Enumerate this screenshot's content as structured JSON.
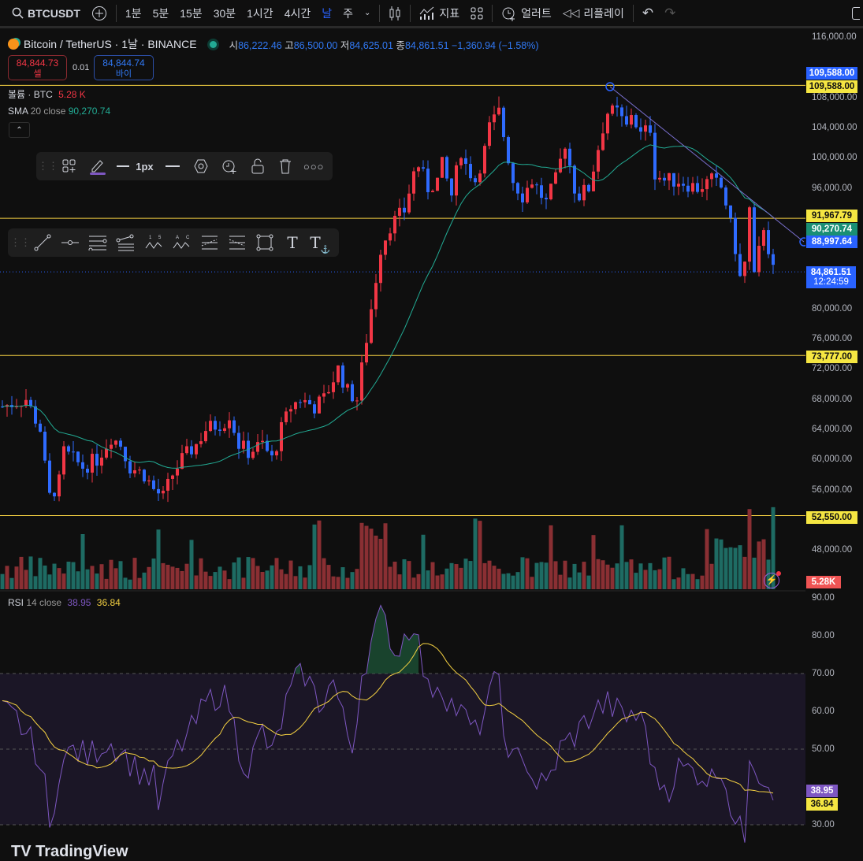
{
  "topbar": {
    "symbol": "BTCUSDT",
    "intervals": [
      "1분",
      "5분",
      "15분",
      "30분",
      "1시간",
      "4시간",
      "날",
      "주"
    ],
    "active_interval": "날",
    "indicators": "지표",
    "alert": "얼러트",
    "replay": "리플레이"
  },
  "legend": {
    "title": "Bitcoin / TetherUS · 1날 · BINANCE",
    "o_label": "시",
    "o": "86,222.46",
    "h_label": "고",
    "h": "86,500.00",
    "l_label": "저",
    "l": "84,625.01",
    "c_label": "종",
    "c": "84,861.51",
    "change": "−1,360.94 (−1.58%)",
    "sell_price": "84,844.73",
    "sell_label": "셀",
    "spread": "0.01",
    "buy_price": "84,844.74",
    "buy_label": "바이"
  },
  "indicators": {
    "volume_label": "볼륨 · BTC",
    "volume_value": "5.28 K",
    "sma_label": "SMA",
    "sma_params": "20 close",
    "sma_value": "90,270.74",
    "rsi_label": "RSI",
    "rsi_params": "14 close",
    "rsi_value": "38.95",
    "rsi_ma_value": "36.84"
  },
  "drawing_toolbar": {
    "width_label": "1px"
  },
  "price_axis": {
    "labels": [
      "116,000.00",
      "108,000.00",
      "104,000.00",
      "100,000.00",
      "96,000.00",
      "80,000.00",
      "76,000.00",
      "72,000.00",
      "68,000.00",
      "64,000.00",
      "60,000.00",
      "56,000.00",
      "48,000.00"
    ],
    "label_values": [
      116000,
      108000,
      104000,
      100000,
      96000,
      80000,
      76000,
      72000,
      68000,
      64000,
      60000,
      56000,
      48000
    ],
    "tags": {
      "trend_high": "109,588.00",
      "hline_high": "109,588.00",
      "hline_mid": "91,967.79",
      "sma": "90,270.74",
      "trend_end": "88,997.64",
      "last": "84,861.51",
      "countdown": "12:24:59",
      "hline_low1": "73,777.00",
      "hline_low2": "52,550.00",
      "volume": "5.28K"
    }
  },
  "rsi_axis": {
    "labels": [
      "90.00",
      "80.00",
      "70.00",
      "60.00",
      "50.00",
      "30.00"
    ],
    "values": [
      90,
      80,
      70,
      60,
      50,
      30
    ],
    "tags": {
      "rsi": "38.95",
      "rsi_ma": "36.84"
    }
  },
  "horizontal_lines": [
    109588,
    91967.79,
    73777,
    52550
  ],
  "last_price": 84861.51,
  "colors": {
    "up": "#f23645",
    "down": "#2f6bff",
    "sma": "#22ab94",
    "rsi": "#7e57c2",
    "rsi_ma": "#f5d142",
    "hline": "#f5d142",
    "vol_up": "#8a2f33",
    "vol_down": "#1e6b63"
  },
  "chart_data": {
    "type": "candlestick",
    "price_waypoints": [
      [
        0,
        67000
      ],
      [
        5,
        68000
      ],
      [
        8,
        64000
      ],
      [
        9,
        59000
      ],
      [
        10,
        55000
      ],
      [
        12,
        57000
      ],
      [
        13,
        61000
      ],
      [
        17,
        59000
      ],
      [
        20,
        60000
      ],
      [
        23,
        63000
      ],
      [
        25,
        62000
      ],
      [
        27,
        59000
      ],
      [
        30,
        58000
      ],
      [
        32,
        56000
      ],
      [
        34,
        55000
      ],
      [
        36,
        58000
      ],
      [
        38,
        60000
      ],
      [
        41,
        62000
      ],
      [
        43,
        64000
      ],
      [
        47,
        65000
      ],
      [
        48,
        66000
      ],
      [
        50,
        62000
      ],
      [
        52,
        61000
      ],
      [
        55,
        62000
      ],
      [
        57,
        60000
      ],
      [
        59,
        64000
      ],
      [
        61,
        67000
      ],
      [
        63,
        68000
      ],
      [
        66,
        67000
      ],
      [
        68,
        68000
      ],
      [
        71,
        72000
      ],
      [
        73,
        69000
      ],
      [
        75,
        68000
      ],
      [
        77,
        76000
      ],
      [
        78,
        80000
      ],
      [
        80,
        88000
      ],
      [
        82,
        91000
      ],
      [
        85,
        93000
      ],
      [
        87,
        98000
      ],
      [
        88,
        99000
      ],
      [
        90,
        96000
      ],
      [
        92,
        97000
      ],
      [
        93,
        99000
      ],
      [
        95,
        95000
      ],
      [
        97,
        101000
      ],
      [
        98,
        99000
      ],
      [
        100,
        97000
      ],
      [
        102,
        101000
      ],
      [
        103,
        104000
      ],
      [
        105,
        106000
      ],
      [
        107,
        100000
      ],
      [
        108,
        97000
      ],
      [
        110,
        95000
      ],
      [
        112,
        97000
      ],
      [
        115,
        94000
      ],
      [
        117,
        97000
      ],
      [
        119,
        102000
      ],
      [
        121,
        96000
      ],
      [
        122,
        95000
      ],
      [
        124,
        96000
      ],
      [
        127,
        104000
      ],
      [
        128,
        106000
      ],
      [
        130,
        106000
      ],
      [
        132,
        104000
      ],
      [
        133,
        106000
      ],
      [
        135,
        103000
      ],
      [
        137,
        104000
      ],
      [
        138,
        98000
      ],
      [
        140,
        97000
      ],
      [
        143,
        97000
      ],
      [
        147,
        96000
      ],
      [
        150,
        97000
      ],
      [
        152,
        96000
      ],
      [
        153,
        94000
      ],
      [
        155,
        88000
      ],
      [
        156,
        84000
      ],
      [
        157,
        86000
      ],
      [
        158,
        93000
      ],
      [
        159,
        84000
      ],
      [
        161,
        91000
      ],
      [
        162,
        88000
      ],
      [
        163,
        85000
      ]
    ],
    "rsi_waypoints": [
      [
        0,
        60
      ],
      [
        3,
        58
      ],
      [
        7,
        50
      ],
      [
        9,
        40
      ],
      [
        10,
        28
      ],
      [
        12,
        45
      ],
      [
        15,
        50
      ],
      [
        18,
        48
      ],
      [
        22,
        52
      ],
      [
        25,
        50
      ],
      [
        28,
        45
      ],
      [
        32,
        42
      ],
      [
        33,
        35
      ],
      [
        36,
        48
      ],
      [
        40,
        55
      ],
      [
        43,
        62
      ],
      [
        46,
        65
      ],
      [
        48,
        62
      ],
      [
        50,
        50
      ],
      [
        52,
        45
      ],
      [
        55,
        55
      ],
      [
        57,
        48
      ],
      [
        60,
        62
      ],
      [
        62,
        68
      ],
      [
        64,
        70
      ],
      [
        67,
        62
      ],
      [
        70,
        68
      ],
      [
        72,
        58
      ],
      [
        74,
        50
      ],
      [
        76,
        70
      ],
      [
        78,
        78
      ],
      [
        80,
        86
      ],
      [
        82,
        80
      ],
      [
        83,
        75
      ],
      [
        86,
        82
      ],
      [
        87,
        84
      ],
      [
        90,
        65
      ],
      [
        92,
        68
      ],
      [
        95,
        62
      ],
      [
        98,
        58
      ],
      [
        100,
        54
      ],
      [
        102,
        60
      ],
      [
        105,
        70
      ],
      [
        107,
        45
      ],
      [
        110,
        50
      ],
      [
        112,
        42
      ],
      [
        115,
        40
      ],
      [
        118,
        50
      ],
      [
        122,
        55
      ],
      [
        125,
        60
      ],
      [
        128,
        62
      ],
      [
        132,
        58
      ],
      [
        133,
        60
      ],
      [
        136,
        56
      ],
      [
        138,
        42
      ],
      [
        141,
        40
      ],
      [
        143,
        45
      ],
      [
        147,
        44
      ],
      [
        150,
        42
      ],
      [
        152,
        46
      ],
      [
        155,
        30
      ],
      [
        157,
        27
      ],
      [
        158,
        50
      ],
      [
        160,
        44
      ],
      [
        163,
        40
      ]
    ]
  }
}
